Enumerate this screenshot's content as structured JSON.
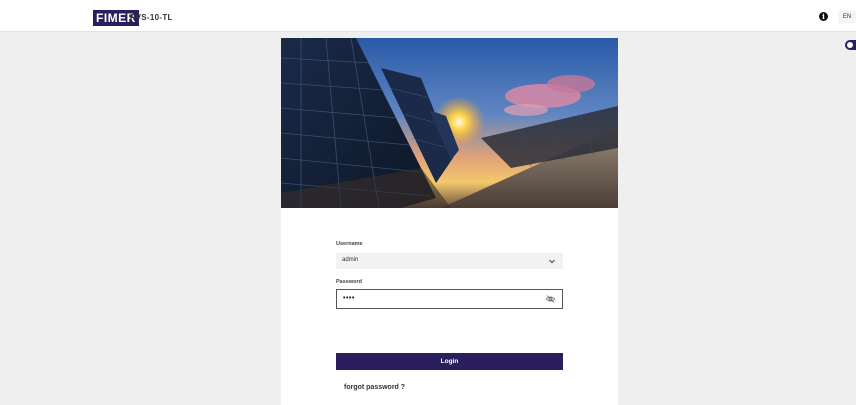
{
  "header": {
    "logo_text": "FIMER",
    "device_name": "PVS-10-TL",
    "info_icon": "info-icon",
    "language": "EN"
  },
  "colors": {
    "brand": "#2a1f5c",
    "background": "#efefef"
  },
  "hero": {
    "image_subject": "solar panels at sunset"
  },
  "form": {
    "username_label": "Username",
    "username_value": "admin",
    "password_label": "Password",
    "password_value": "••••",
    "login_label": "Login",
    "forgot_label": "forgot password ?"
  }
}
